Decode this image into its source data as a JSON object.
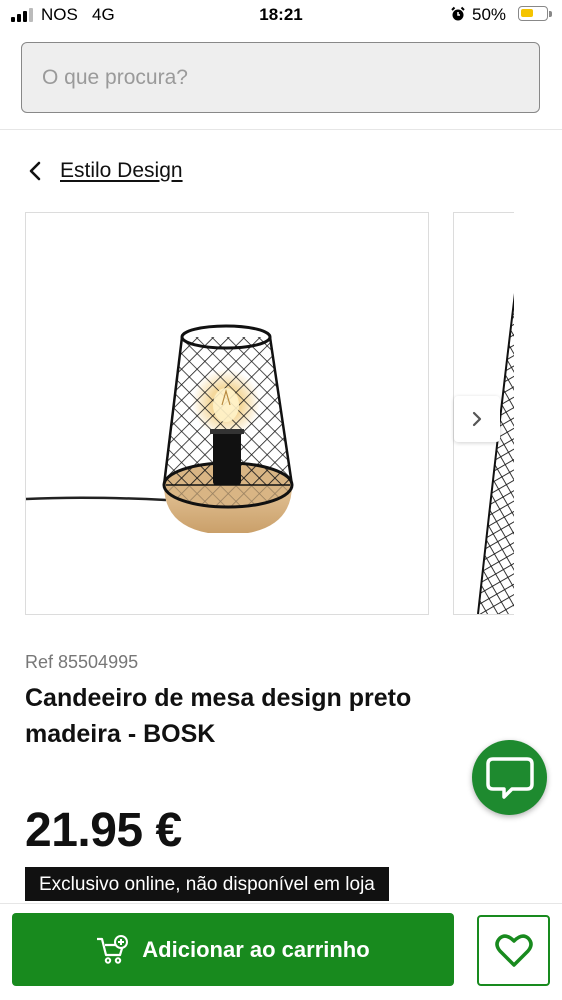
{
  "status_bar": {
    "carrier": "NOS",
    "network": "4G",
    "time": "18:21",
    "battery_percent": "50%",
    "battery_level": 0.5,
    "battery_color": "#f5c400"
  },
  "search": {
    "placeholder": "O que procura?",
    "value": ""
  },
  "breadcrumb": {
    "back_icon": "chevron-left-icon",
    "label": "Estilo Design"
  },
  "gallery": {
    "image_alt": "lamp-product-image",
    "next_icon": "chevron-right-icon"
  },
  "product": {
    "ref": "Ref 85504995",
    "title": "Candeeiro de mesa design preto madeira - BOSK",
    "price": "21.95 €",
    "availability": "Exclusivo online, não disponível em loja"
  },
  "actions": {
    "add_to_cart": "Adicionar ao carrinho",
    "cart_icon": "cart-add-icon",
    "wishlist_icon": "heart-icon",
    "chat_icon": "chat-bubble-icon"
  },
  "colors": {
    "brand_green": "#188a1e",
    "chat_green": "#1e8a2f",
    "badge_bg": "#111111"
  }
}
